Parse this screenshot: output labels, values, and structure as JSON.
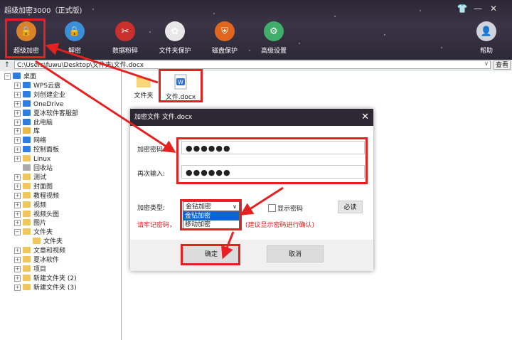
{
  "app": {
    "title": "超级加密3000（正式版)"
  },
  "toolbar": [
    {
      "name": "super-encrypt-tool",
      "icon": "lock-icon",
      "label": "超级加密",
      "color": "#d9822b"
    },
    {
      "name": "decrypt-tool",
      "icon": "lock-icon",
      "label": "解密",
      "color": "#3a8fd8"
    },
    {
      "name": "shred-tool",
      "icon": "scissors-icon",
      "label": "数据粉碎",
      "color": "#c9302c"
    },
    {
      "name": "folder-protect-tool",
      "icon": "flower-icon",
      "label": "文件夹保护",
      "color": "#e8e8e8"
    },
    {
      "name": "disk-protect-tool",
      "icon": "shield-icon",
      "label": "磁盘保护",
      "color": "#e0661e"
    },
    {
      "name": "advanced-settings-tool",
      "icon": "gear-icon",
      "label": "高级设置",
      "color": "#3fae6b"
    },
    {
      "name": "help-tool",
      "icon": "user-icon",
      "label": "帮助",
      "color": "#cfd4dc"
    }
  ],
  "pathbar": {
    "path": "C:\\Users\\fuwu\\Desktop\\文件夹\\文件.docx",
    "browse": "查看"
  },
  "tree": [
    {
      "label": "桌面",
      "color": "#2f7de1"
    },
    {
      "label": "WPS云盘",
      "color": "#2f7de1"
    },
    {
      "label": "刘创建企业",
      "color": "#2f7de1"
    },
    {
      "label": "OneDrive",
      "color": "#2f7de1"
    },
    {
      "label": "夏冰软件客服部",
      "color": "#2f7de1"
    },
    {
      "label": "此电脑",
      "color": "#2f7de1"
    },
    {
      "label": "库",
      "color": "#e8b84a"
    },
    {
      "label": "网络",
      "color": "#2f7de1"
    },
    {
      "label": "控制面板",
      "color": "#2f7de1"
    },
    {
      "label": "Linux",
      "color": "#f0c75e"
    },
    {
      "label": "回收站",
      "color": "#aaaaaa"
    },
    {
      "label": "测试",
      "color": "#f0c75e"
    },
    {
      "label": "封面图",
      "color": "#f0c75e"
    },
    {
      "label": "教程视频",
      "color": "#f0c75e"
    },
    {
      "label": "视频",
      "color": "#f0c75e"
    },
    {
      "label": "视频头图",
      "color": "#f0c75e"
    },
    {
      "label": "图片",
      "color": "#f0c75e"
    },
    {
      "label": "文件夹",
      "color": "#f0c75e"
    },
    {
      "label": "文件夹",
      "color": "#f0c75e"
    },
    {
      "label": "文章和视频",
      "color": "#f0c75e"
    },
    {
      "label": "夏冰软件",
      "color": "#f0c75e"
    },
    {
      "label": "项目",
      "color": "#f0c75e"
    },
    {
      "label": "新建文件夹 (2)",
      "color": "#f0c75e"
    },
    {
      "label": "新建文件夹 (3)",
      "color": "#f0c75e"
    }
  ],
  "files": [
    {
      "label": "文件夹",
      "icon": "folder-icon"
    },
    {
      "label": "文件.docx",
      "icon": "word-doc-icon"
    }
  ],
  "dialog": {
    "title": "加密文件 文件.docx",
    "password_label": "加密密码:",
    "password_value": "●●●●●●",
    "confirm_label": "再次输入:",
    "confirm_value": "●●●●●●",
    "type_label": "加密类型:",
    "type_selected": "金钻加密",
    "type_options": [
      "金钻加密",
      "移动加密"
    ],
    "show_password": "显示密码",
    "must_read": "必读",
    "warning_left": "请牢记密码，",
    "warning_right": "(建议显示密码进行确认)",
    "ok": "确定",
    "cancel": "取消"
  },
  "accent": "#e52020"
}
